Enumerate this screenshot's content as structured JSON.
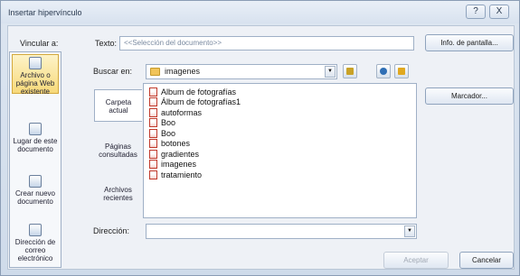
{
  "window": {
    "title": "Insertar hipervínculo",
    "help_button": "?",
    "close_button": "X"
  },
  "link_to_label": "Vincular a:",
  "text_label": "Texto:",
  "text_value": "<<Selección del documento>>",
  "screen_tip_button": "Info. de pantalla...",
  "nav": [
    {
      "label": "Archivo o página Web existente",
      "icon": "globe-page-icon"
    },
    {
      "label": "Lugar de este documento",
      "icon": "document-place-icon"
    },
    {
      "label": "Crear nuevo documento",
      "icon": "new-document-icon"
    },
    {
      "label": "Dirección de correo electrónico",
      "icon": "email-icon"
    }
  ],
  "look_in_label": "Buscar en:",
  "look_in_value": "imagenes",
  "subtabs": [
    {
      "label": "Carpeta actual"
    },
    {
      "label": "Páginas consultadas"
    },
    {
      "label": "Archivos recientes"
    }
  ],
  "files": [
    "Album de fotografías",
    "Álbum de fotografías1",
    "autoformas",
    "Boo",
    "Boo",
    "botones",
    "gradientes",
    "imagenes",
    "tratamiento"
  ],
  "bookmark_button": "Marcador...",
  "address_label": "Dirección:",
  "address_value": "",
  "ok_button": "Aceptar",
  "cancel_button": "Cancelar",
  "colors": {
    "accent": "#f7d97a",
    "folder": "#f1c45a",
    "frame": "#d8e2ef"
  }
}
